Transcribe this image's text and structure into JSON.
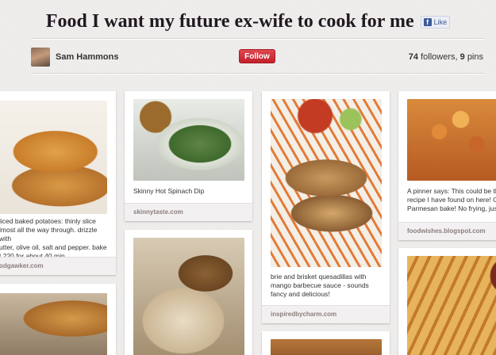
{
  "board": {
    "title": "Food I want my future ex-wife to cook for me",
    "like_label": "Like",
    "owner": "Sam Hammons",
    "follow_label": "Follow",
    "followers_count": "74",
    "followers_label": "followers,",
    "pins_count": "9",
    "pins_label": "pins"
  },
  "pins": [
    {
      "desc": "liced baked potatoes: thinly slice\nlmost all the way through. drizzle with\nutter, olive oil, salt and pepper. bake\nt 220 for about 40 min.",
      "source": "odgawker.com"
    },
    {
      "desc": "Skinny Hot Spinach Dip",
      "source": "skinnytaste.com"
    },
    {
      "desc": "brie and brisket quesadillas with\nmango barbecue sauce - sounds\nfancy and delicious!",
      "source": "inspiredbycharm.com"
    },
    {
      "desc": "A pinner says: This could be th\nrecipe I have found on here! Ch\nParmesan bake! No frying, just",
      "source": "foodwishes.blogspot.com"
    }
  ]
}
